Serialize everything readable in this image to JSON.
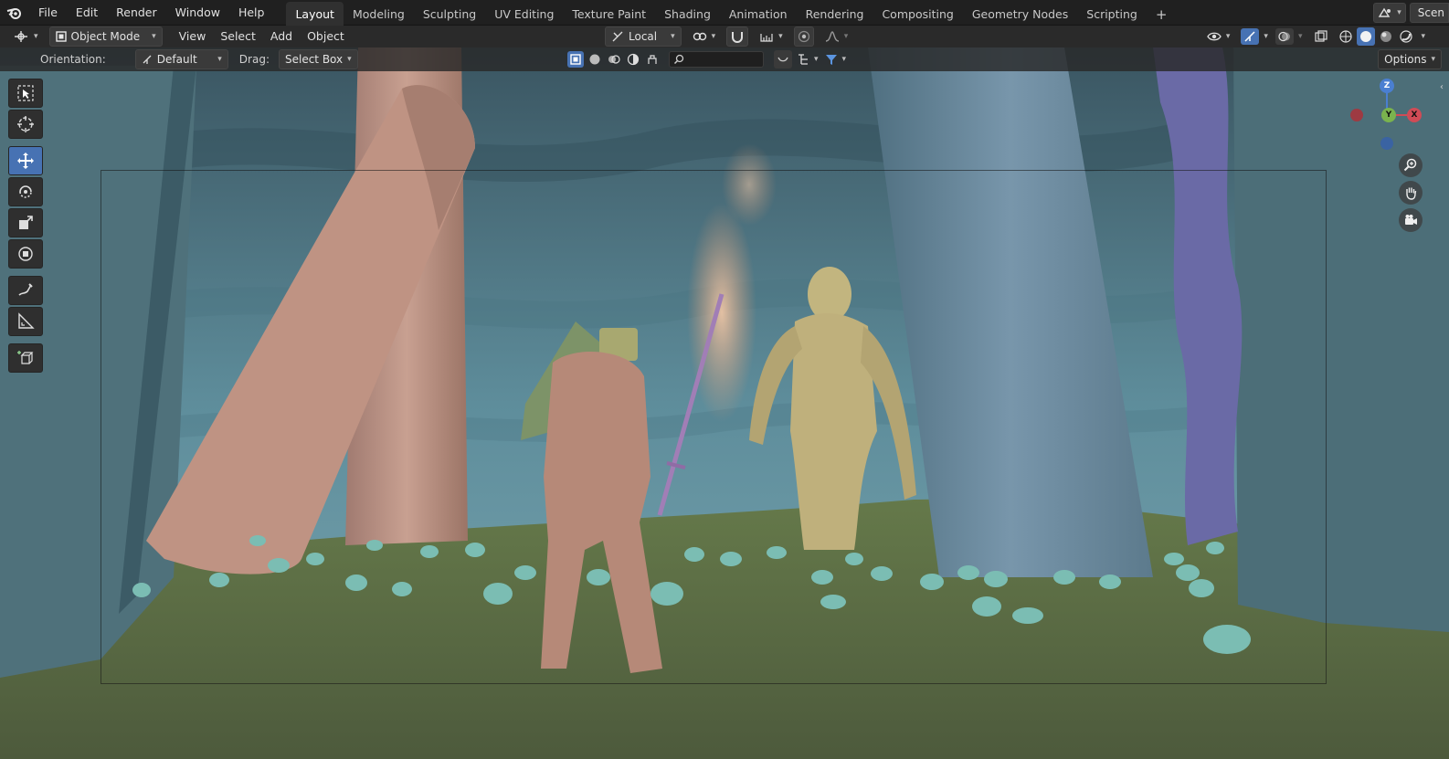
{
  "topbar": {
    "menus": [
      "File",
      "Edit",
      "Render",
      "Window",
      "Help"
    ],
    "workspaces": [
      "Layout",
      "Modeling",
      "Sculpting",
      "UV Editing",
      "Texture Paint",
      "Shading",
      "Animation",
      "Rendering",
      "Compositing",
      "Geometry Nodes",
      "Scripting"
    ],
    "active_workspace": "Layout",
    "add_tab": "+",
    "scene_label": "Scen"
  },
  "header": {
    "mode": "Object Mode",
    "menus": [
      "View",
      "Select",
      "Add",
      "Object"
    ],
    "pivot": "Local"
  },
  "toolset": {
    "orientation_label": "Orientation:",
    "orientation_value": "Default",
    "drag_label": "Drag:",
    "drag_value": "Select Box",
    "search_placeholder": "",
    "options_label": "Options"
  },
  "gizmo": {
    "z": "Z",
    "y": "Y",
    "x": "X"
  },
  "colors": {
    "accent": "#4772b3",
    "bg": "#1d1d1d",
    "header": "#2a2a2a"
  },
  "tools": [
    "select-box-icon",
    "cursor-icon",
    "move-icon",
    "rotate-icon",
    "scale-icon",
    "transform-icon",
    "annotate-icon",
    "measure-icon",
    "add-cube-icon"
  ]
}
